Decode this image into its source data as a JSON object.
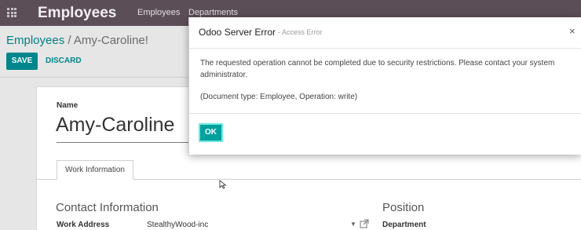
{
  "navbar": {
    "apps_icon": "apps-grid-icon",
    "brand": "Employees",
    "menu": [
      "Employees",
      "Departments"
    ]
  },
  "breadcrumb": {
    "parent": "Employees",
    "separator": "/",
    "current": "Amy-Caroline!"
  },
  "toolbar": {
    "save_label": "SAVE",
    "discard_label": "DISCARD"
  },
  "form": {
    "name_label": "Name",
    "name_value": "Amy-Caroline",
    "tab_label": "Work Information",
    "contact_section": "Contact Information",
    "position_section": "Position",
    "work_address_label": "Work Address",
    "work_address_value": "StealthyWood-inc",
    "department_label": "Department"
  },
  "modal": {
    "title": "Odoo Server Error",
    "subtitle": "- Access Error",
    "close": "×",
    "message": "The requested operation cannot be completed due to security restrictions. Please contact your system administrator.",
    "detail": "(Document type: Employee, Operation: write)",
    "ok_label": "OK"
  },
  "colors": {
    "navbar": "#5b4e57",
    "primary": "#00868b",
    "ok_button": "#00a09d"
  }
}
